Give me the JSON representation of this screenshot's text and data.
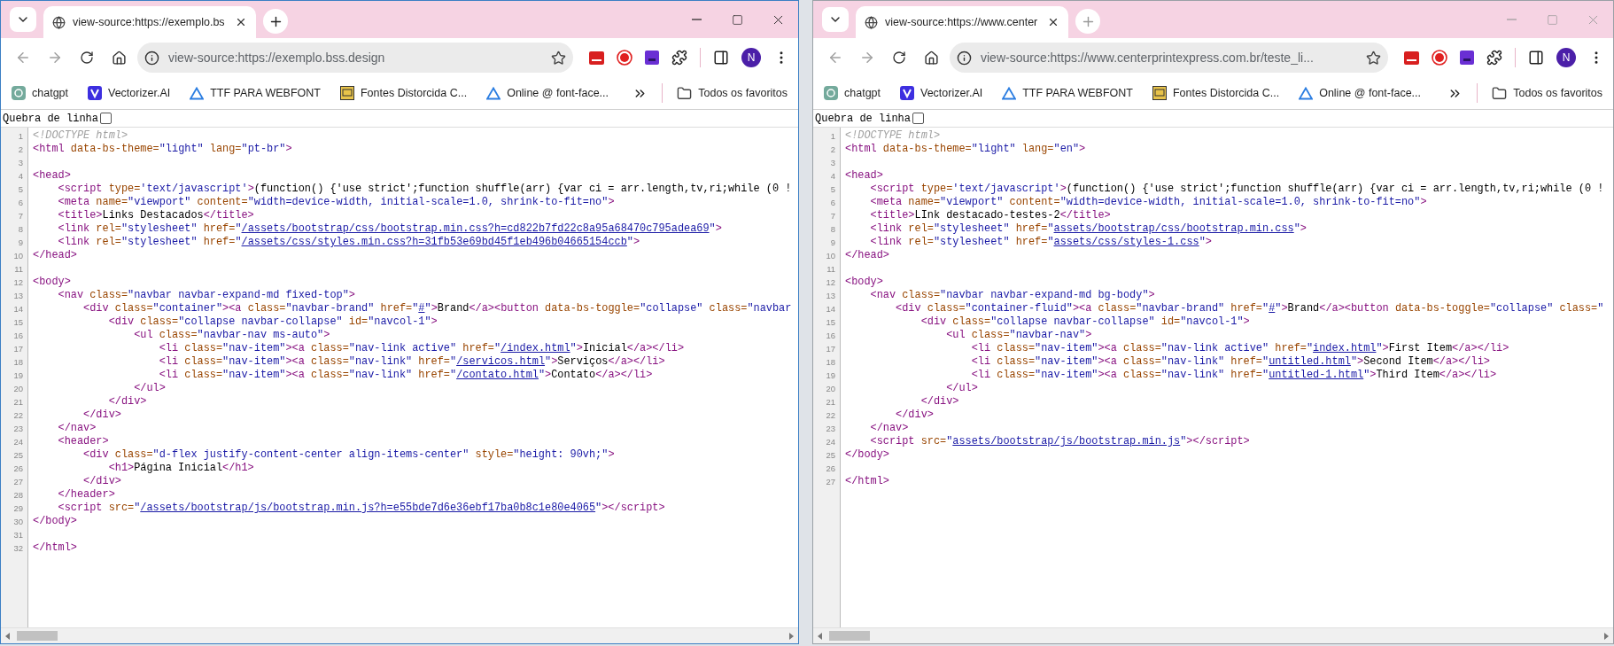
{
  "windows": [
    {
      "active": true,
      "tab": {
        "title": "view-source:https://exemplo.bs"
      },
      "address": "view-source:https://exemplo.bss.design",
      "avatar": "N",
      "bookmarks": [
        {
          "kind": "swirl",
          "label": "chatgpt"
        },
        {
          "kind": "logo",
          "label": "Vectorizer.AI"
        },
        {
          "kind": "triangle",
          "label": "TTF PARA WEBFONT"
        },
        {
          "kind": "tile",
          "label": "Fontes Distorcida C..."
        },
        {
          "kind": "triangle",
          "label": "Online @ font-face..."
        }
      ],
      "folder": "Todos os favoritos",
      "wrap_toggle": {
        "label": "Quebra de linha",
        "checked": false
      },
      "code_lines": [
        {
          "number": "1",
          "tokens": [
            {
              "kind": "doctype",
              "text": "<!DOCTYPE html>"
            }
          ]
        },
        {
          "number": "2",
          "tokens": [
            {
              "kind": "tag",
              "text": "<html"
            },
            {
              "kind": "attr",
              "text": " data-bs-theme="
            },
            {
              "kind": "val",
              "text": "\"light\""
            },
            {
              "kind": "attr",
              "text": " lang="
            },
            {
              "kind": "val",
              "text": "\"pt-br\""
            },
            {
              "kind": "tag",
              "text": ">"
            }
          ]
        },
        {
          "number": "3"
        },
        {
          "number": "4",
          "tokens": [
            {
              "kind": "tag",
              "text": "<head>"
            }
          ]
        },
        {
          "number": "5",
          "tokens": [
            {
              "kind": "tag",
              "text": "    <script"
            },
            {
              "kind": "attr",
              "text": " type="
            },
            {
              "kind": "val",
              "text": "'text/javascript'"
            },
            {
              "kind": "tag",
              "text": ">"
            },
            {
              "kind": "text",
              "text": "(function() {'use strict';function shuffle(arr) {var ci = arr.length,tv,ri;while (0 !"
            }
          ]
        },
        {
          "number": "6",
          "tokens": [
            {
              "kind": "tag",
              "text": "    <meta"
            },
            {
              "kind": "attr",
              "text": " name="
            },
            {
              "kind": "val",
              "text": "\"viewport\""
            },
            {
              "kind": "attr",
              "text": " content="
            },
            {
              "kind": "val",
              "text": "\"width=device-width, initial-scale=1.0, shrink-to-fit=no\""
            },
            {
              "kind": "tag",
              "text": ">"
            }
          ]
        },
        {
          "number": "7",
          "tokens": [
            {
              "kind": "tag",
              "text": "    <title>"
            },
            {
              "kind": "text",
              "text": "Links Destacados"
            },
            {
              "kind": "tag",
              "text": "</title>"
            }
          ]
        },
        {
          "number": "8",
          "tokens": [
            {
              "kind": "tag",
              "text": "    <link"
            },
            {
              "kind": "attr",
              "text": " rel="
            },
            {
              "kind": "val",
              "text": "\"stylesheet\""
            },
            {
              "kind": "attr",
              "text": " href="
            },
            {
              "kind": "val",
              "text": "\""
            },
            {
              "kind": "link",
              "text": "/assets/bootstrap/css/bootstrap.min.css?h=cd822b7fd22c8a95a68470c795adea69"
            },
            {
              "kind": "val",
              "text": "\""
            },
            {
              "kind": "tag",
              "text": ">"
            }
          ]
        },
        {
          "number": "9",
          "tokens": [
            {
              "kind": "tag",
              "text": "    <link"
            },
            {
              "kind": "attr",
              "text": " rel="
            },
            {
              "kind": "val",
              "text": "\"stylesheet\""
            },
            {
              "kind": "attr",
              "text": " href="
            },
            {
              "kind": "val",
              "text": "\""
            },
            {
              "kind": "link",
              "text": "/assets/css/styles.min.css?h=31fb53e69bd45f1eb496b04665154ccb"
            },
            {
              "kind": "val",
              "text": "\""
            },
            {
              "kind": "tag",
              "text": ">"
            }
          ]
        },
        {
          "number": "10",
          "tokens": [
            {
              "kind": "tag",
              "text": "</head>"
            }
          ]
        },
        {
          "number": "11"
        },
        {
          "number": "12",
          "tokens": [
            {
              "kind": "tag",
              "text": "<body>"
            }
          ]
        },
        {
          "number": "13",
          "tokens": [
            {
              "kind": "tag",
              "text": "    <nav"
            },
            {
              "kind": "attr",
              "text": " class="
            },
            {
              "kind": "val",
              "text": "\"navbar navbar-expand-md fixed-top\""
            },
            {
              "kind": "tag",
              "text": ">"
            }
          ]
        },
        {
          "number": "14",
          "tokens": [
            {
              "kind": "tag",
              "text": "        <div"
            },
            {
              "kind": "attr",
              "text": " class="
            },
            {
              "kind": "val",
              "text": "\"container\""
            },
            {
              "kind": "tag",
              "text": "><a"
            },
            {
              "kind": "attr",
              "text": " class="
            },
            {
              "kind": "val",
              "text": "\"navbar-brand\""
            },
            {
              "kind": "attr",
              "text": " href="
            },
            {
              "kind": "val",
              "text": "\""
            },
            {
              "kind": "link",
              "text": "#"
            },
            {
              "kind": "val",
              "text": "\""
            },
            {
              "kind": "tag",
              "text": ">"
            },
            {
              "kind": "text",
              "text": "Brand"
            },
            {
              "kind": "tag",
              "text": "</a><button"
            },
            {
              "kind": "attr",
              "text": " data-bs-toggle="
            },
            {
              "kind": "val",
              "text": "\"collapse\""
            },
            {
              "kind": "attr",
              "text": " class="
            },
            {
              "kind": "val",
              "text": "\"navbar"
            }
          ]
        },
        {
          "number": "15",
          "tokens": [
            {
              "kind": "tag",
              "text": "            <div"
            },
            {
              "kind": "attr",
              "text": " class="
            },
            {
              "kind": "val",
              "text": "\"collapse navbar-collapse\""
            },
            {
              "kind": "attr",
              "text": " id="
            },
            {
              "kind": "val",
              "text": "\"navcol-1\""
            },
            {
              "kind": "tag",
              "text": ">"
            }
          ]
        },
        {
          "number": "16",
          "tokens": [
            {
              "kind": "tag",
              "text": "                <ul"
            },
            {
              "kind": "attr",
              "text": " class="
            },
            {
              "kind": "val",
              "text": "\"navbar-nav ms-auto\""
            },
            {
              "kind": "tag",
              "text": ">"
            }
          ]
        },
        {
          "number": "17",
          "tokens": [
            {
              "kind": "tag",
              "text": "                    <li"
            },
            {
              "kind": "attr",
              "text": " class="
            },
            {
              "kind": "val",
              "text": "\"nav-item\""
            },
            {
              "kind": "tag",
              "text": "><a"
            },
            {
              "kind": "attr",
              "text": " class="
            },
            {
              "kind": "val",
              "text": "\"nav-link active\""
            },
            {
              "kind": "attr",
              "text": " href="
            },
            {
              "kind": "val",
              "text": "\""
            },
            {
              "kind": "link",
              "text": "/index.html"
            },
            {
              "kind": "val",
              "text": "\""
            },
            {
              "kind": "tag",
              "text": ">"
            },
            {
              "kind": "text",
              "text": "Inicial"
            },
            {
              "kind": "tag",
              "text": "</a></li>"
            }
          ]
        },
        {
          "number": "18",
          "tokens": [
            {
              "kind": "tag",
              "text": "                    <li"
            },
            {
              "kind": "attr",
              "text": " class="
            },
            {
              "kind": "val",
              "text": "\"nav-item\""
            },
            {
              "kind": "tag",
              "text": "><a"
            },
            {
              "kind": "attr",
              "text": " class="
            },
            {
              "kind": "val",
              "text": "\"nav-link\""
            },
            {
              "kind": "attr",
              "text": " href="
            },
            {
              "kind": "val",
              "text": "\""
            },
            {
              "kind": "link",
              "text": "/servicos.html"
            },
            {
              "kind": "val",
              "text": "\""
            },
            {
              "kind": "tag",
              "text": ">"
            },
            {
              "kind": "text",
              "text": "Serviços"
            },
            {
              "kind": "tag",
              "text": "</a></li>"
            }
          ]
        },
        {
          "number": "19",
          "tokens": [
            {
              "kind": "tag",
              "text": "                    <li"
            },
            {
              "kind": "attr",
              "text": " class="
            },
            {
              "kind": "val",
              "text": "\"nav-item\""
            },
            {
              "kind": "tag",
              "text": "><a"
            },
            {
              "kind": "attr",
              "text": " class="
            },
            {
              "kind": "val",
              "text": "\"nav-link\""
            },
            {
              "kind": "attr",
              "text": " href="
            },
            {
              "kind": "val",
              "text": "\""
            },
            {
              "kind": "link",
              "text": "/contato.html"
            },
            {
              "kind": "val",
              "text": "\""
            },
            {
              "kind": "tag",
              "text": ">"
            },
            {
              "kind": "text",
              "text": "Contato"
            },
            {
              "kind": "tag",
              "text": "</a></li>"
            }
          ]
        },
        {
          "number": "20",
          "tokens": [
            {
              "kind": "tag",
              "text": "                </ul>"
            }
          ]
        },
        {
          "number": "21",
          "tokens": [
            {
              "kind": "tag",
              "text": "            </div>"
            }
          ]
        },
        {
          "number": "22",
          "tokens": [
            {
              "kind": "tag",
              "text": "        </div>"
            }
          ]
        },
        {
          "number": "23",
          "tokens": [
            {
              "kind": "tag",
              "text": "    </nav>"
            }
          ]
        },
        {
          "number": "24",
          "tokens": [
            {
              "kind": "tag",
              "text": "    <header>"
            }
          ]
        },
        {
          "number": "25",
          "tokens": [
            {
              "kind": "tag",
              "text": "        <div"
            },
            {
              "kind": "attr",
              "text": " class="
            },
            {
              "kind": "val",
              "text": "\"d-flex justify-content-center align-items-center\""
            },
            {
              "kind": "attr",
              "text": " style="
            },
            {
              "kind": "val",
              "text": "\"height: 90vh;\""
            },
            {
              "kind": "tag",
              "text": ">"
            }
          ]
        },
        {
          "number": "26",
          "tokens": [
            {
              "kind": "tag",
              "text": "            <h1>"
            },
            {
              "kind": "text",
              "text": "Página Inicial"
            },
            {
              "kind": "tag",
              "text": "</h1>"
            }
          ]
        },
        {
          "number": "27",
          "tokens": [
            {
              "kind": "tag",
              "text": "        </div>"
            }
          ]
        },
        {
          "number": "28",
          "tokens": [
            {
              "kind": "tag",
              "text": "    </header>"
            }
          ]
        },
        {
          "number": "29",
          "tokens": [
            {
              "kind": "tag",
              "text": "    <script"
            },
            {
              "kind": "attr",
              "text": " src="
            },
            {
              "kind": "val",
              "text": "\""
            },
            {
              "kind": "link",
              "text": "/assets/bootstrap/js/bootstrap.min.js?h=e55bde7d6e36ebf17ba0b8c1e80e4065"
            },
            {
              "kind": "val",
              "text": "\""
            },
            {
              "kind": "tag",
              "text": "></script>"
            }
          ]
        },
        {
          "number": "30",
          "tokens": [
            {
              "kind": "tag",
              "text": "</body>"
            }
          ]
        },
        {
          "number": "31"
        },
        {
          "number": "32",
          "tokens": [
            {
              "kind": "tag",
              "text": "</html>"
            }
          ]
        }
      ]
    },
    {
      "active": false,
      "tab": {
        "title": "view-source:https://www.center"
      },
      "address": "view-source:https://www.centerprintexpress.com.br/teste_li...",
      "avatar": "N",
      "bookmarks": [
        {
          "kind": "swirl",
          "label": "chatgpt"
        },
        {
          "kind": "logo",
          "label": "Vectorizer.AI"
        },
        {
          "kind": "triangle",
          "label": "TTF PARA WEBFONT"
        },
        {
          "kind": "tile",
          "label": "Fontes Distorcida C..."
        },
        {
          "kind": "triangle",
          "label": "Online @ font-face..."
        }
      ],
      "folder": "Todos os favoritos",
      "wrap_toggle": {
        "label": "Quebra de linha",
        "checked": false
      },
      "code_lines": [
        {
          "number": "1",
          "tokens": [
            {
              "kind": "doctype",
              "text": "<!DOCTYPE html>"
            }
          ]
        },
        {
          "number": "2",
          "tokens": [
            {
              "kind": "tag",
              "text": "<html"
            },
            {
              "kind": "attr",
              "text": " data-bs-theme="
            },
            {
              "kind": "val",
              "text": "\"light\""
            },
            {
              "kind": "attr",
              "text": " lang="
            },
            {
              "kind": "val",
              "text": "\"en\""
            },
            {
              "kind": "tag",
              "text": ">"
            }
          ]
        },
        {
          "number": "3"
        },
        {
          "number": "4",
          "tokens": [
            {
              "kind": "tag",
              "text": "<head>"
            }
          ]
        },
        {
          "number": "5",
          "tokens": [
            {
              "kind": "tag",
              "text": "    <script"
            },
            {
              "kind": "attr",
              "text": " type="
            },
            {
              "kind": "val",
              "text": "'text/javascript'"
            },
            {
              "kind": "tag",
              "text": ">"
            },
            {
              "kind": "text",
              "text": "(function() {'use strict';function shuffle(arr) {var ci = arr.length,tv,ri;while (0 !"
            }
          ]
        },
        {
          "number": "6",
          "tokens": [
            {
              "kind": "tag",
              "text": "    <meta"
            },
            {
              "kind": "attr",
              "text": " name="
            },
            {
              "kind": "val",
              "text": "\"viewport\""
            },
            {
              "kind": "attr",
              "text": " content="
            },
            {
              "kind": "val",
              "text": "\"width=device-width, initial-scale=1.0, shrink-to-fit=no\""
            },
            {
              "kind": "tag",
              "text": ">"
            }
          ]
        },
        {
          "number": "7",
          "tokens": [
            {
              "kind": "tag",
              "text": "    <title>"
            },
            {
              "kind": "text",
              "text": "LInk destacado-testes-2"
            },
            {
              "kind": "tag",
              "text": "</title>"
            }
          ]
        },
        {
          "number": "8",
          "tokens": [
            {
              "kind": "tag",
              "text": "    <link"
            },
            {
              "kind": "attr",
              "text": " rel="
            },
            {
              "kind": "val",
              "text": "\"stylesheet\""
            },
            {
              "kind": "attr",
              "text": " href="
            },
            {
              "kind": "val",
              "text": "\""
            },
            {
              "kind": "link",
              "text": "assets/bootstrap/css/bootstrap.min.css"
            },
            {
              "kind": "val",
              "text": "\""
            },
            {
              "kind": "tag",
              "text": ">"
            }
          ]
        },
        {
          "number": "9",
          "tokens": [
            {
              "kind": "tag",
              "text": "    <link"
            },
            {
              "kind": "attr",
              "text": " rel="
            },
            {
              "kind": "val",
              "text": "\"stylesheet\""
            },
            {
              "kind": "attr",
              "text": " href="
            },
            {
              "kind": "val",
              "text": "\""
            },
            {
              "kind": "link",
              "text": "assets/css/styles-1.css"
            },
            {
              "kind": "val",
              "text": "\""
            },
            {
              "kind": "tag",
              "text": ">"
            }
          ]
        },
        {
          "number": "10",
          "tokens": [
            {
              "kind": "tag",
              "text": "</head>"
            }
          ]
        },
        {
          "number": "11"
        },
        {
          "number": "12",
          "tokens": [
            {
              "kind": "tag",
              "text": "<body>"
            }
          ]
        },
        {
          "number": "13",
          "tokens": [
            {
              "kind": "tag",
              "text": "    <nav"
            },
            {
              "kind": "attr",
              "text": " class="
            },
            {
              "kind": "val",
              "text": "\"navbar navbar-expand-md bg-body\""
            },
            {
              "kind": "tag",
              "text": ">"
            }
          ]
        },
        {
          "number": "14",
          "tokens": [
            {
              "kind": "tag",
              "text": "        <div"
            },
            {
              "kind": "attr",
              "text": " class="
            },
            {
              "kind": "val",
              "text": "\"container-fluid\""
            },
            {
              "kind": "tag",
              "text": "><a"
            },
            {
              "kind": "attr",
              "text": " class="
            },
            {
              "kind": "val",
              "text": "\"navbar-brand\""
            },
            {
              "kind": "attr",
              "text": " href="
            },
            {
              "kind": "val",
              "text": "\""
            },
            {
              "kind": "link",
              "text": "#"
            },
            {
              "kind": "val",
              "text": "\""
            },
            {
              "kind": "tag",
              "text": ">"
            },
            {
              "kind": "text",
              "text": "Brand"
            },
            {
              "kind": "tag",
              "text": "</a><button"
            },
            {
              "kind": "attr",
              "text": " data-bs-toggle="
            },
            {
              "kind": "val",
              "text": "\"collapse\""
            },
            {
              "kind": "attr",
              "text": " class="
            },
            {
              "kind": "val",
              "text": "\""
            }
          ]
        },
        {
          "number": "15",
          "tokens": [
            {
              "kind": "tag",
              "text": "            <div"
            },
            {
              "kind": "attr",
              "text": " class="
            },
            {
              "kind": "val",
              "text": "\"collapse navbar-collapse\""
            },
            {
              "kind": "attr",
              "text": " id="
            },
            {
              "kind": "val",
              "text": "\"navcol-1\""
            },
            {
              "kind": "tag",
              "text": ">"
            }
          ]
        },
        {
          "number": "16",
          "tokens": [
            {
              "kind": "tag",
              "text": "                <ul"
            },
            {
              "kind": "attr",
              "text": " class="
            },
            {
              "kind": "val",
              "text": "\"navbar-nav\""
            },
            {
              "kind": "tag",
              "text": ">"
            }
          ]
        },
        {
          "number": "17",
          "tokens": [
            {
              "kind": "tag",
              "text": "                    <li"
            },
            {
              "kind": "attr",
              "text": " class="
            },
            {
              "kind": "val",
              "text": "\"nav-item\""
            },
            {
              "kind": "tag",
              "text": "><a"
            },
            {
              "kind": "attr",
              "text": " class="
            },
            {
              "kind": "val",
              "text": "\"nav-link active\""
            },
            {
              "kind": "attr",
              "text": " href="
            },
            {
              "kind": "val",
              "text": "\""
            },
            {
              "kind": "link",
              "text": "index.html"
            },
            {
              "kind": "val",
              "text": "\""
            },
            {
              "kind": "tag",
              "text": ">"
            },
            {
              "kind": "text",
              "text": "First Item"
            },
            {
              "kind": "tag",
              "text": "</a></li>"
            }
          ]
        },
        {
          "number": "18",
          "tokens": [
            {
              "kind": "tag",
              "text": "                    <li"
            },
            {
              "kind": "attr",
              "text": " class="
            },
            {
              "kind": "val",
              "text": "\"nav-item\""
            },
            {
              "kind": "tag",
              "text": "><a"
            },
            {
              "kind": "attr",
              "text": " class="
            },
            {
              "kind": "val",
              "text": "\"nav-link\""
            },
            {
              "kind": "attr",
              "text": " href="
            },
            {
              "kind": "val",
              "text": "\""
            },
            {
              "kind": "link",
              "text": "untitled.html"
            },
            {
              "kind": "val",
              "text": "\""
            },
            {
              "kind": "tag",
              "text": ">"
            },
            {
              "kind": "text",
              "text": "Second Item"
            },
            {
              "kind": "tag",
              "text": "</a></li>"
            }
          ]
        },
        {
          "number": "19",
          "tokens": [
            {
              "kind": "tag",
              "text": "                    <li"
            },
            {
              "kind": "attr",
              "text": " class="
            },
            {
              "kind": "val",
              "text": "\"nav-item\""
            },
            {
              "kind": "tag",
              "text": "><a"
            },
            {
              "kind": "attr",
              "text": " class="
            },
            {
              "kind": "val",
              "text": "\"nav-link\""
            },
            {
              "kind": "attr",
              "text": " href="
            },
            {
              "kind": "val",
              "text": "\""
            },
            {
              "kind": "link",
              "text": "untitled-1.html"
            },
            {
              "kind": "val",
              "text": "\""
            },
            {
              "kind": "tag",
              "text": ">"
            },
            {
              "kind": "text",
              "text": "Third Item"
            },
            {
              "kind": "tag",
              "text": "</a></li>"
            }
          ]
        },
        {
          "number": "20",
          "tokens": [
            {
              "kind": "tag",
              "text": "                </ul>"
            }
          ]
        },
        {
          "number": "21",
          "tokens": [
            {
              "kind": "tag",
              "text": "            </div>"
            }
          ]
        },
        {
          "number": "22",
          "tokens": [
            {
              "kind": "tag",
              "text": "        </div>"
            }
          ]
        },
        {
          "number": "23",
          "tokens": [
            {
              "kind": "tag",
              "text": "    </nav>"
            }
          ]
        },
        {
          "number": "24",
          "tokens": [
            {
              "kind": "tag",
              "text": "    <script"
            },
            {
              "kind": "attr",
              "text": " src="
            },
            {
              "kind": "val",
              "text": "\""
            },
            {
              "kind": "link",
              "text": "assets/bootstrap/js/bootstrap.min.js"
            },
            {
              "kind": "val",
              "text": "\""
            },
            {
              "kind": "tag",
              "text": "></script>"
            }
          ]
        },
        {
          "number": "25",
          "tokens": [
            {
              "kind": "tag",
              "text": "</body>"
            }
          ]
        },
        {
          "number": "26"
        },
        {
          "number": "27",
          "tokens": [
            {
              "kind": "tag",
              "text": "</html>"
            }
          ]
        }
      ]
    }
  ]
}
